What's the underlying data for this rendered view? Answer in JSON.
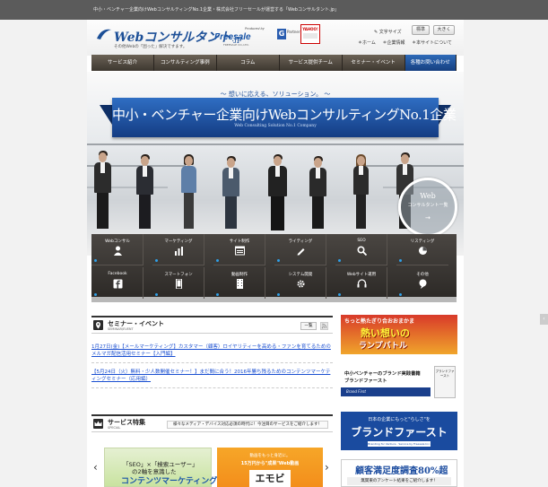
{
  "window": {
    "title": "中小・ベンチャー企業向けWebコンサルティングNo.1企業・株式会社フリーセールが運営する「Webコンサルタント.jp」"
  },
  "header": {
    "logo_main": "Webコンサルタント",
    "logo_suffix": ".jp",
    "logo_tagline": "その他Webの「困った」解決ですます。",
    "produced_by": "Produced by",
    "freesale": "Freesale",
    "freesale_sub": "FREESALE CO.,LTD.",
    "partner_label": "Partner",
    "yahoo_label": "YAHOO!",
    "font_size_label": "✎ 文字サイズ",
    "font_standard": "標準",
    "font_large": "大きく",
    "util_links": [
      "＊ホーム",
      "＊企業情報",
      "＊本サイトについて"
    ]
  },
  "nav": {
    "items": [
      "サービス紹介",
      "コンサルティング事例",
      "コラム",
      "サービス提供チーム",
      "セミナー・イベント",
      "各種お問い合わせ"
    ]
  },
  "hero": {
    "tagline": "～ 想いに応える、ソリューション。 ～",
    "title": "中小・ベンチャー企業向けWebコンサルティングNo.1企業",
    "subtitle": "Web Consulting Solution No.1 Company",
    "circle_big": "Web",
    "circle_small": "コンサルタント一覧",
    "circle_arrow": "→"
  },
  "service_grid": {
    "row1": [
      "Webコンサル",
      "マーケティング",
      "サイト制作",
      "ライティング",
      "SEO",
      "リスティング"
    ],
    "row2": [
      "Facebook",
      "スマートフォン",
      "動画制作",
      "システム開発",
      "Webサイト運用",
      "その他"
    ]
  },
  "seminar": {
    "title": "セミナー・イベント",
    "en": "SEMINAR/EVENT",
    "list_btn": "一覧",
    "items": [
      "1月27日(金)【メールマーケティング】カスタマー（顧客）ロイヤリティーを高める・ファンを育てるためのメルマガ配信活用セミナー【入門編】",
      "【5月24日（火）無料・少人数開催セミナー！】まだ間に合う！2016年勝ち残るためのコンテンツマーケティングセミナー（応用編）"
    ]
  },
  "service_special": {
    "title": "サービス特集",
    "en": "SPECIAL",
    "desc": "様々なメディア・デバイス対応必須の時代に！今注目のサービスをご紹介します！"
  },
  "carousel": {
    "prev": "‹",
    "next": "›",
    "p1_line1": "「SEO」×「検索ユーザー」",
    "p1_line2": "の2軸を意識した",
    "p1_line3": "コンテンツマーケティング",
    "p2_line1": "動画をもっと身近に。",
    "p2_line2": "15万円から\"成果\"Web動画",
    "p2_logo": "エモビ"
  },
  "sidebar": {
    "b1_line1": "ちっと熱たぎり合おおまかま",
    "b1_line2": "熱い想いの",
    "b1_line3": "ランプバトル",
    "b2_line1": "中小ベンチャーのブランド実践書籍",
    "b2_line2": "ブランドファースト",
    "b2_bar": "Brand First",
    "b2_book": "ブランドファースト",
    "b3_line1": "日本の企業にもっと\"らしさ\"を",
    "b3_line2": "ブランドファースト",
    "b3_line3": "Branding for Venture · Service by Freesale Inc.",
    "b4_line1": "顧客満足度調査80%超",
    "b4_line2": "無関東のアンケート結果をご紹介します！"
  },
  "right_tab": "‹"
}
